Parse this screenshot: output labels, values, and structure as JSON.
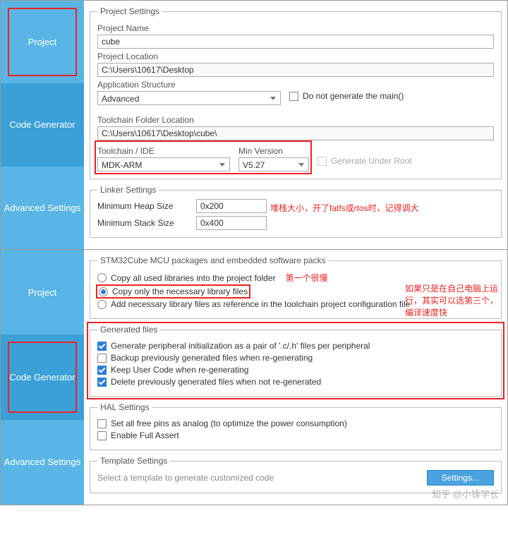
{
  "sidebar_top": [
    "Project",
    "Code Generator",
    "Advanced Settings"
  ],
  "sidebar_bottom": [
    "Project",
    "Code Generator",
    "Advanced Settings"
  ],
  "project_settings": {
    "legend": "Project Settings",
    "name_label": "Project Name",
    "name_value": "cube",
    "location_label": "Project Location",
    "location_value": "C:\\Users\\10617\\Desktop",
    "app_structure_label": "Application Structure",
    "app_structure_value": "Advanced",
    "no_main_label": "Do not generate the main()",
    "tc_folder_label": "Toolchain Folder Location",
    "tc_folder_value": "C:\\Users\\10617\\Desktop\\cube\\",
    "tc_ide_label": "Toolchain / IDE",
    "tc_ide_value": "MDK-ARM",
    "min_ver_label": "Min Version",
    "min_ver_value": "V5.27",
    "gen_under_root_label": "Generate Under Root"
  },
  "linker": {
    "legend": "Linker Settings",
    "heap_label": "Minimum Heap Size",
    "heap_value": "0x200",
    "stack_label": "Minimum Stack Size",
    "stack_value": "0x400",
    "note": "堆栈大小，开了fatfs或rtos时，记得调大"
  },
  "packages": {
    "legend": "STM32Cube MCU packages and embedded software packs",
    "opt1": "Copy all used libraries into the project folder",
    "opt2": "Copy only the necessary library files",
    "opt3": "Add necessary library files as reference in the toolchain project configuration file",
    "note1": "第一个很慢",
    "note2": "如果只是在自己电脑上运行，其实可以选第三个，编译速度快"
  },
  "genfiles": {
    "legend": "Generated files",
    "o1": "Generate peripheral initialization as a pair of '.c/.h' files per peripheral",
    "o2": "Backup previously generated files when re-generating",
    "o3": "Keep User Code when re-generating",
    "o4": "Delete previously generated files when not re-generated"
  },
  "hal": {
    "legend": "HAL Settings",
    "o1": "Set all free pins as analog (to optimize the power consumption)",
    "o2": "Enable Full Assert"
  },
  "template": {
    "legend": "Template Settings",
    "text": "Select a template to generate customized code",
    "btn": "Settings..."
  },
  "watermark": "知乎 @小锋学长"
}
